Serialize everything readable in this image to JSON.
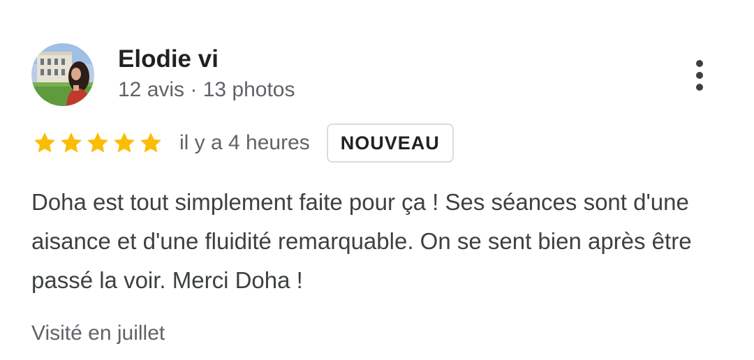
{
  "review": {
    "author": {
      "name": "Elodie vi",
      "meta": "12 avis · 13 photos"
    },
    "rating": 5,
    "max_rating": 5,
    "time_ago": "il y a 4 heures",
    "badge": "NOUVEAU",
    "text": "Doha est tout simplement faite pour ça ! Ses séances sont d'une aisance et d'une fluidité remarquable. On se sent bien après être passé la voir. Merci Doha !",
    "visited": "Visité en juillet"
  },
  "icons": {
    "star": "star-icon",
    "more": "more-vert-icon"
  },
  "colors": {
    "star": "#fbbc04",
    "name": "#202124",
    "secondary": "#5f6368",
    "body": "#3c4043",
    "badge_border": "#dadce0"
  }
}
